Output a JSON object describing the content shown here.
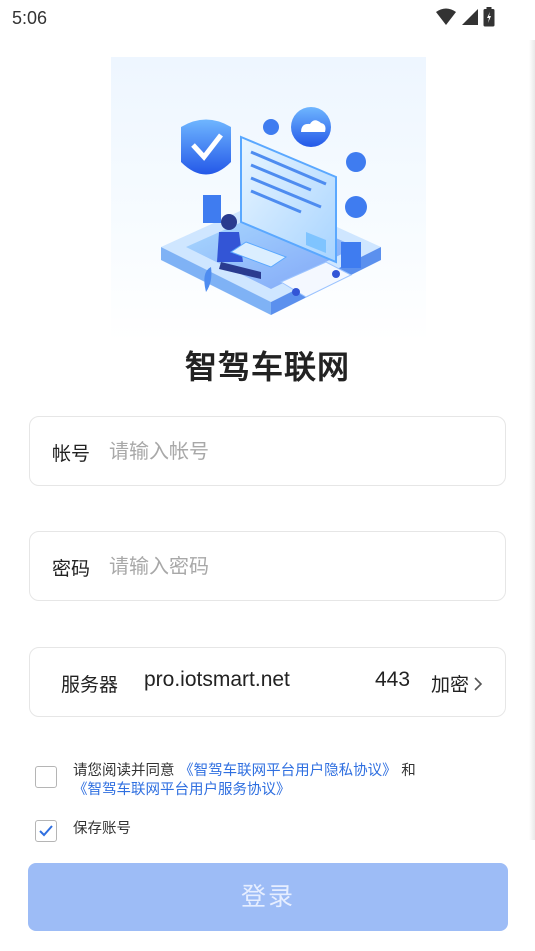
{
  "status_bar": {
    "time": "5:06"
  },
  "app": {
    "title": "智驾车联网"
  },
  "account": {
    "label": "帐号",
    "placeholder": "请输入帐号",
    "value": ""
  },
  "password": {
    "label": "密码",
    "placeholder": "请输入密码",
    "value": ""
  },
  "server": {
    "label": "服务器",
    "host": "pro.iotsmart.net",
    "port": "443",
    "encryption": "加密"
  },
  "agreement": {
    "prefix": "请您阅读并同意",
    "privacy_link": "《智驾车联网平台用户隐私协议》",
    "joiner": "和",
    "service_link": "《智驾车联网平台用户服务协议》",
    "checked": false
  },
  "save_account": {
    "label": "保存账号",
    "checked": true
  },
  "login_button": {
    "label": "登录"
  },
  "colors": {
    "accent": "#2f6fe0",
    "button_disabled": "#9dbcf6",
    "check": "#2f6fe0"
  }
}
